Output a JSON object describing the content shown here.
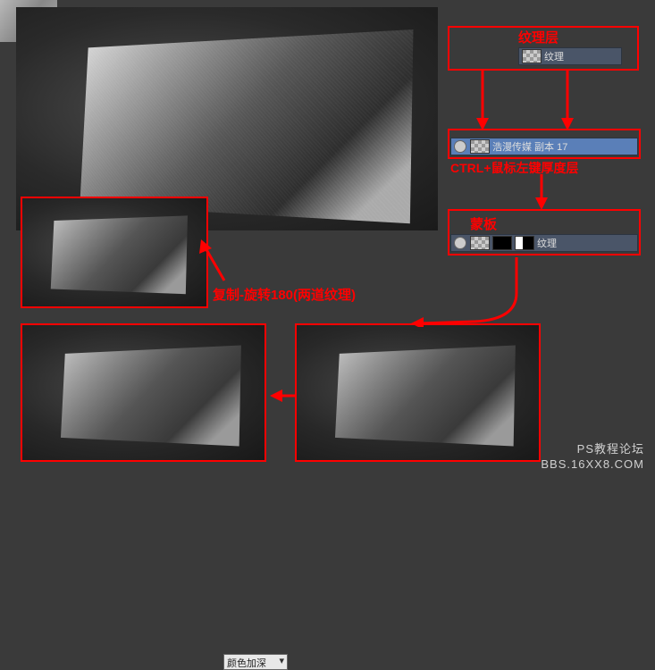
{
  "labels": {
    "texture_layer": "纹理层",
    "ctrl_hint": "CTRL+鼠标左键厚度层",
    "mask": "蒙板",
    "copy_rotate": "复制-旋转180(两道纹理)",
    "blend_mode": "颜色加深"
  },
  "layers": {
    "texture_name": "纹理",
    "copy_name": "浩漫传媒 副本 17",
    "mask_name": "纹理"
  },
  "watermark": {
    "line1": "PS教程论坛",
    "line2": "BBS.16XX8.COM"
  }
}
